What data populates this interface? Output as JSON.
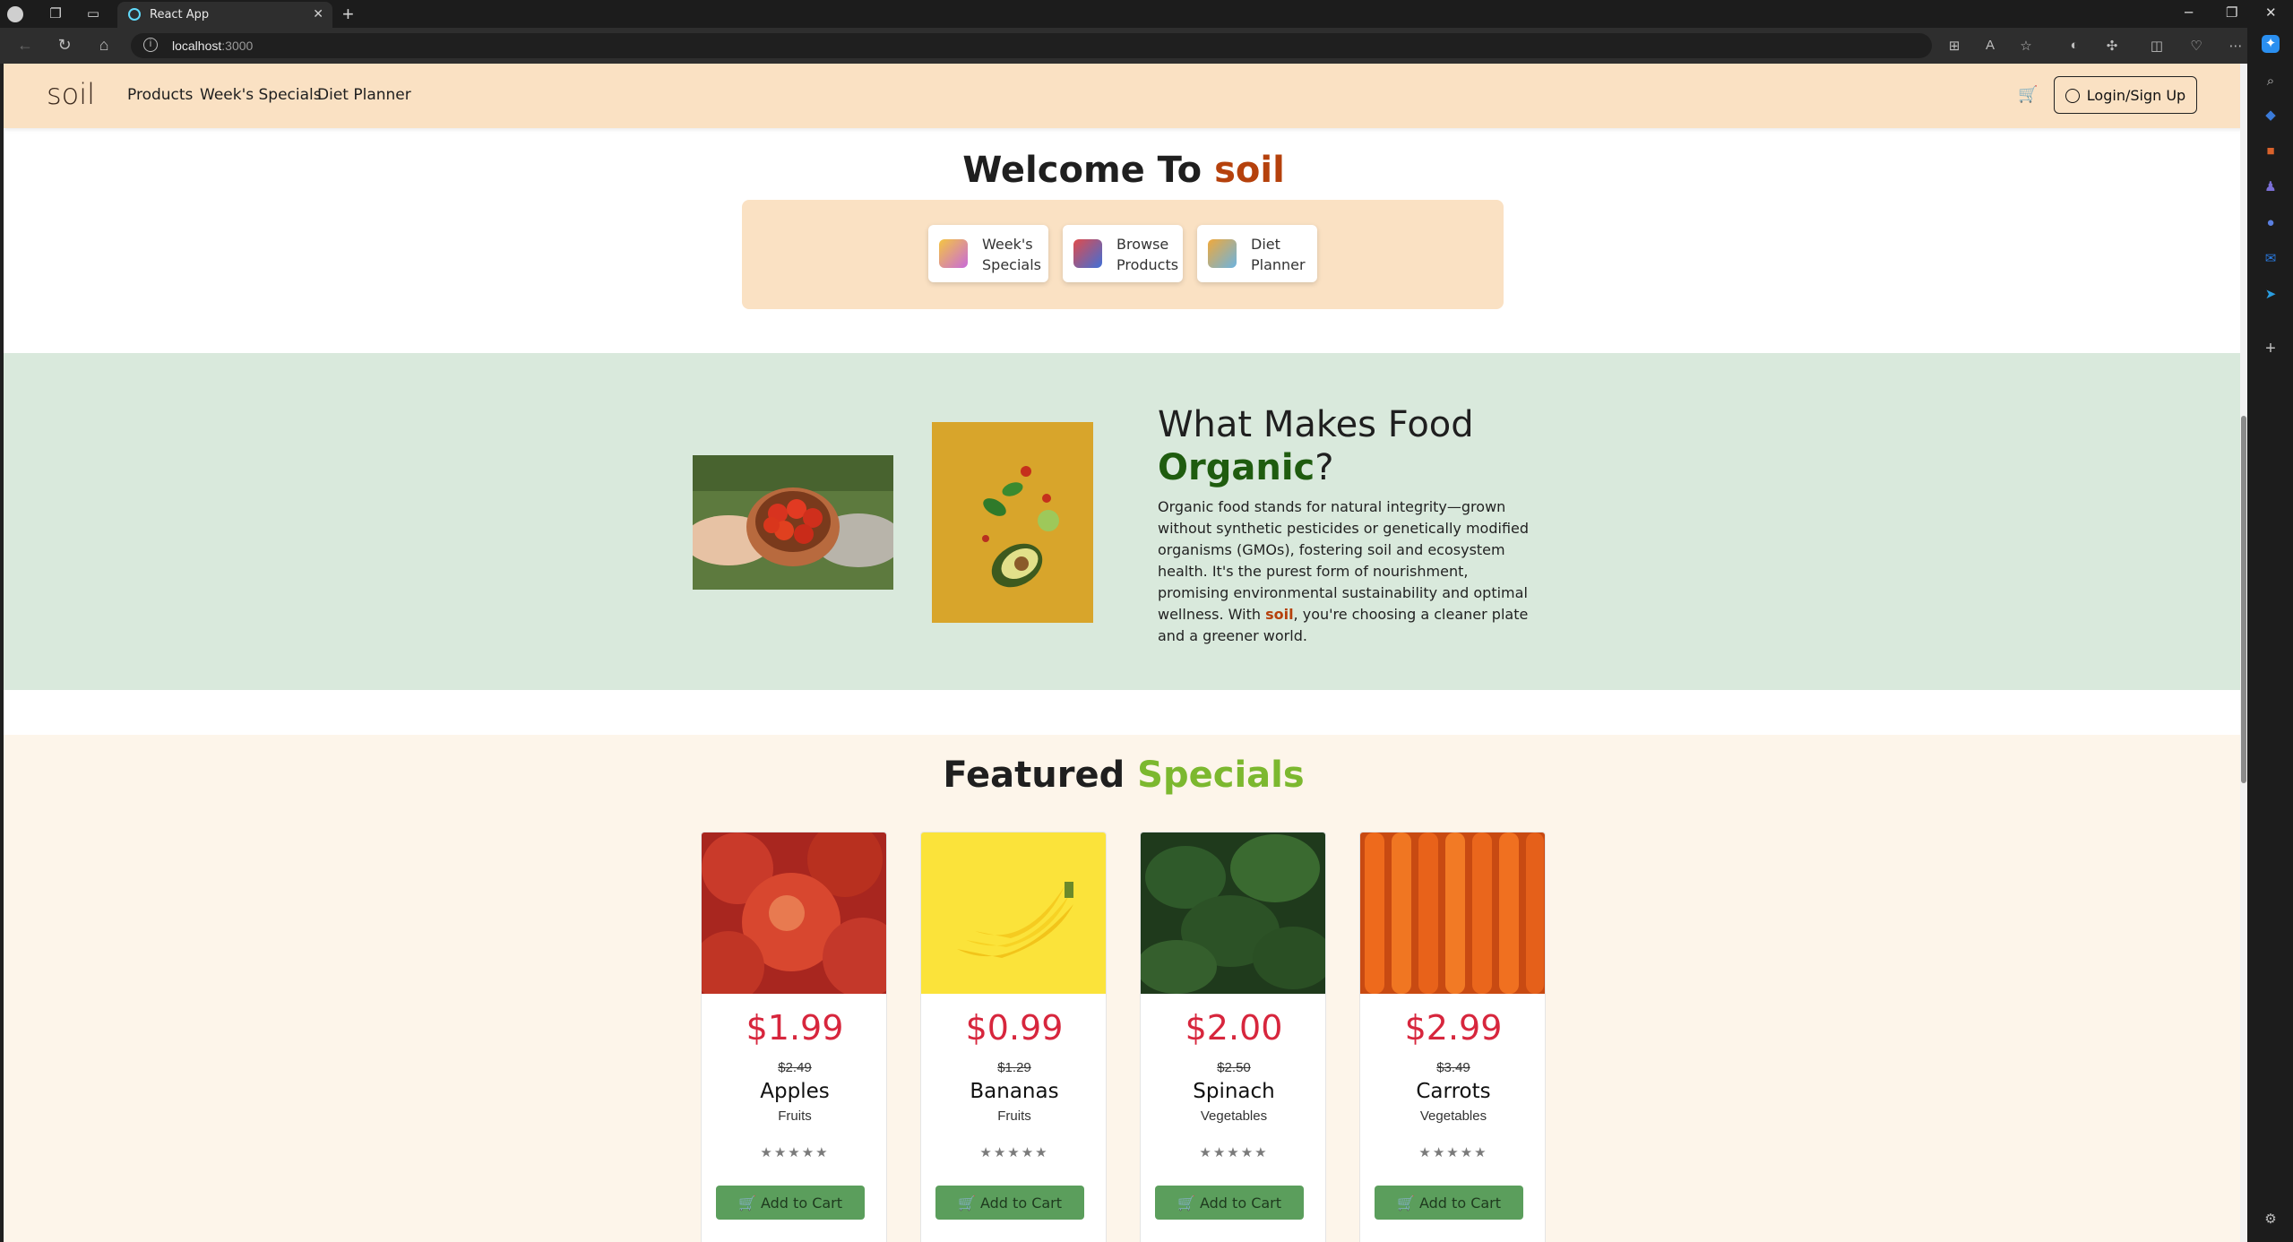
{
  "browser": {
    "tab_title": "React App",
    "url_host": "localhost",
    "url_port": ":3000"
  },
  "navbar": {
    "brand": "soil",
    "links": [
      "Products",
      "Week's Specials",
      "Diet Planner"
    ],
    "login_label": "Login/Sign Up"
  },
  "welcome": {
    "prefix": "Welcome To ",
    "brand": "soil",
    "quick_links": [
      {
        "line1": "Week's",
        "line2": "Specials",
        "icon": "specials-icon"
      },
      {
        "line1": "Browse",
        "line2": "Products",
        "icon": "browse-products-icon"
      },
      {
        "line1": "Diet",
        "line2": "Planner",
        "icon": "diet-planner-icon"
      }
    ]
  },
  "organic": {
    "heading_line1": "What Makes Food",
    "heading_highlight": "Organic",
    "heading_suffix": "?",
    "text_before": "Organic food stands for natural integrity—grown without synthetic pesticides or genetically modified organisms (GMOs), fostering soil and ecosystem health. It's the purest form of nourishment, promising environmental sustainability and optimal wellness. With ",
    "text_brand": "soil",
    "text_after": ", you're choosing a cleaner plate and a greener world."
  },
  "featured": {
    "heading_prefix": "Featured ",
    "heading_highlight": "Specials",
    "products": [
      {
        "price": "$1.99",
        "old_price": "$2.49",
        "name": "Apples",
        "category": "Fruits",
        "stars": "★★★★★",
        "button": "Add to Cart"
      },
      {
        "price": "$0.99",
        "old_price": "$1.29",
        "name": "Bananas",
        "category": "Fruits",
        "stars": "★★★★★",
        "button": "Add to Cart"
      },
      {
        "price": "$2.00",
        "old_price": "$2.50",
        "name": "Spinach",
        "category": "Vegetables",
        "stars": "★★★★★",
        "button": "Add to Cart"
      },
      {
        "price": "$2.99",
        "old_price": "$3.49",
        "name": "Carrots",
        "category": "Vegetables",
        "stars": "★★★★★",
        "button": "Add to Cart"
      }
    ]
  },
  "colors": {
    "nav_bg": "#fae1c3",
    "brand_accent": "#b5410c",
    "organic_bg": "#d9e9dc",
    "organic_green": "#1f5c0f",
    "specials_green": "#7cb82f",
    "price_red": "#d7263d",
    "button_green": "#5b9e5c"
  }
}
